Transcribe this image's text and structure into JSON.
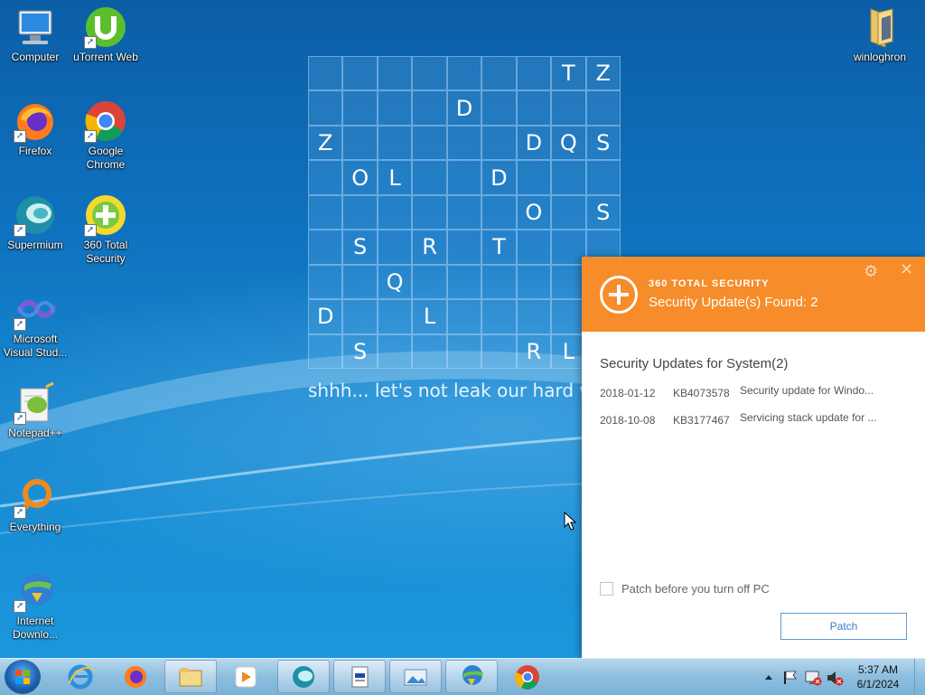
{
  "desktop_icons": [
    {
      "label": "Computer"
    },
    {
      "label": "uTorrent Web"
    },
    {
      "label": "Firefox"
    },
    {
      "label": "Google Chrome"
    },
    {
      "label": "Supermium"
    },
    {
      "label": "360 Total Security"
    },
    {
      "label": "Microsoft Visual Stud..."
    },
    {
      "label": "Notepad++"
    },
    {
      "label": "Everything"
    },
    {
      "label": "Internet Downlo..."
    },
    {
      "label": "winloghron"
    }
  ],
  "wallpaper": {
    "grid_rows": [
      [
        "",
        "",
        "",
        "",
        "",
        "",
        "",
        "T",
        "Z"
      ],
      [
        "",
        "",
        "",
        "",
        "D",
        "",
        "",
        "",
        ""
      ],
      [
        "Z",
        "",
        "",
        "",
        "",
        "",
        "D",
        "Q",
        "S"
      ],
      [
        "",
        "O",
        "L",
        "",
        "",
        "D",
        "",
        "",
        ""
      ],
      [
        "",
        "",
        "",
        "",
        "",
        "",
        "O",
        "",
        "S"
      ],
      [
        "",
        "S",
        "",
        "R",
        "",
        "T",
        "",
        "",
        ""
      ],
      [
        "",
        "",
        "Q",
        "",
        "",
        "",
        "",
        "",
        ""
      ],
      [
        "D",
        "",
        "",
        "L",
        "",
        "",
        "",
        "",
        ""
      ],
      [
        "",
        "S",
        "",
        "",
        "",
        "",
        "R",
        "L",
        ""
      ]
    ],
    "tagline": "shhh... let's not leak our hard w"
  },
  "popup": {
    "brand": "360 TOTAL SECURITY",
    "title": "Security Update(s) Found: 2",
    "section": "Security Updates for System(2)",
    "updates": [
      {
        "date": "2018-01-12",
        "kb": "KB4073578",
        "title": "Security update for Windo..."
      },
      {
        "date": "2018-10-08",
        "kb": "KB3177467",
        "title": "Servicing stack update for ..."
      }
    ],
    "checkbox_label": "Patch before you turn off PC",
    "checkbox_checked": false,
    "patch_button": "Patch",
    "accent": "#f68c2a"
  },
  "taskbar": {
    "time": "5:37 AM",
    "date": "6/1/2024",
    "pinned": [
      "internet-explorer",
      "firefox",
      "file-explorer",
      "media-player",
      "supermium",
      "notepad-document",
      "picture-viewer",
      "internet-download-manager",
      "chrome"
    ]
  }
}
